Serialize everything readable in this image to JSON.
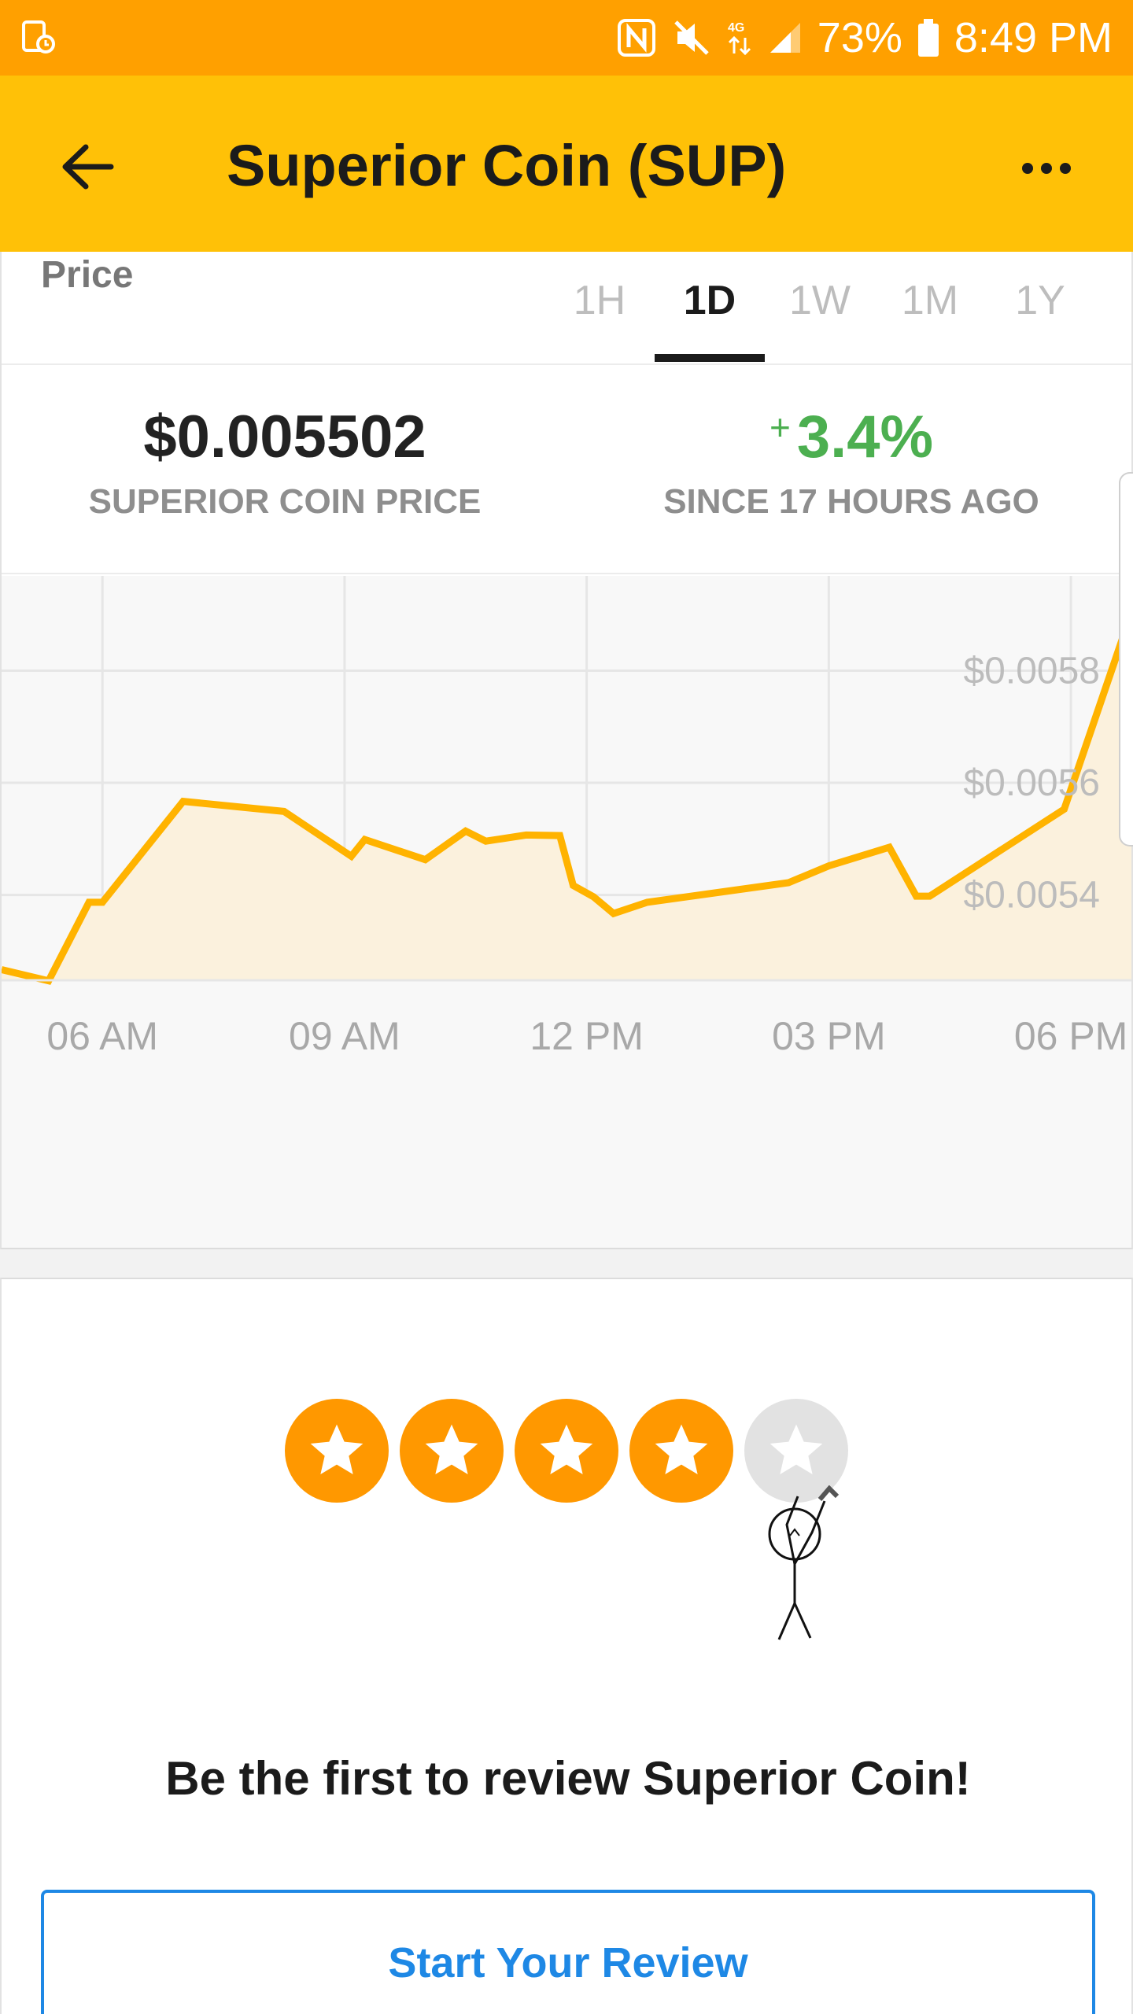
{
  "status_bar": {
    "battery_percent": "73%",
    "time": "8:49 PM",
    "network_label": "4G",
    "icons": [
      "screen-record-icon",
      "nfc-icon",
      "mute-icon",
      "data-arrows-icon",
      "signal-icon",
      "battery-icon"
    ]
  },
  "app_bar": {
    "title": "Superior Coin (SUP)",
    "back_icon": "arrow-left-icon",
    "more_icon": "more-horizontal-icon"
  },
  "price_tabs": {
    "label": "Price",
    "tabs": [
      {
        "label": "1H",
        "active": false
      },
      {
        "label": "1D",
        "active": true
      },
      {
        "label": "1W",
        "active": false
      },
      {
        "label": "1M",
        "active": false
      },
      {
        "label": "1Y",
        "active": false
      }
    ]
  },
  "stats": {
    "price_value": "$0.005502",
    "price_label": "SUPERIOR COIN PRICE",
    "change_sign": "+",
    "change_value": "3.4%",
    "change_label": "SINCE 17 HOURS AGO"
  },
  "colors": {
    "status_bar": "#ffa000",
    "app_bar": "#ffc107",
    "chart_line": "#ffb300",
    "chart_fill": "#fbf1dd",
    "positive": "#4caf50",
    "star_filled": "#ff9800",
    "star_empty": "#e2e2e2",
    "link_blue": "#1e88e5"
  },
  "chart_data": {
    "type": "area",
    "x": [
      "04:45",
      "05:20",
      "05:50",
      "06:00",
      "07:00",
      "08:15",
      "09:05",
      "09:15",
      "10:00",
      "10:30",
      "10:45",
      "11:15",
      "11:40",
      "11:50",
      "12:05",
      "12:20",
      "12:45",
      "14:30",
      "15:00",
      "15:45",
      "16:05",
      "16:15",
      "17:55",
      "18:45"
    ],
    "y": [
      0.005267,
      0.005247,
      0.005387,
      0.005387,
      0.005567,
      0.005549,
      0.005469,
      0.005499,
      0.005463,
      0.005514,
      0.005496,
      0.005507,
      0.005506,
      0.005417,
      0.005397,
      0.005367,
      0.005387,
      0.005422,
      0.005452,
      0.005485,
      0.005398,
      0.005398,
      0.005553,
      0.005904
    ],
    "y_tick_labels": [
      "$0.0054",
      "$0.0056",
      "$0.0058"
    ],
    "y_ticks": [
      0.0054,
      0.0056,
      0.0058
    ],
    "x_tick_labels": [
      "06 AM",
      "09 AM",
      "12 PM",
      "03 PM",
      "06 PM"
    ],
    "ylim": [
      0.005248,
      0.005969
    ],
    "xlim": [
      "04:45",
      "18:45"
    ],
    "grid": true,
    "title": "",
    "xlabel": "",
    "ylabel": ""
  },
  "review": {
    "rating_filled": 4,
    "rating_total": 5,
    "prompt": "Be the first to review Superior Coin!",
    "button_label": "Start Your Review"
  }
}
